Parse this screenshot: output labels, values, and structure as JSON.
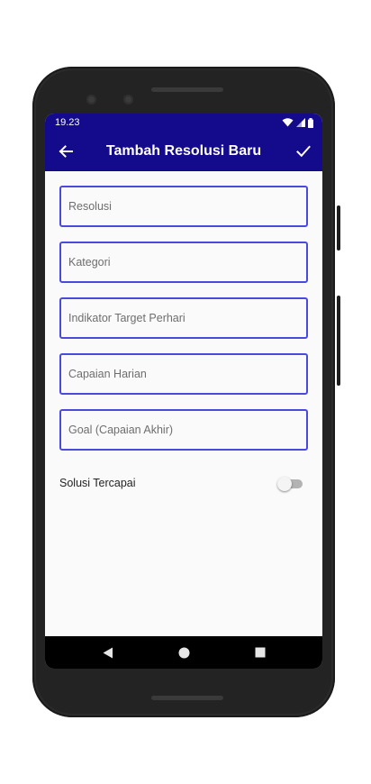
{
  "status_bar": {
    "time": "19.23"
  },
  "app_bar": {
    "title": "Tambah Resolusi Baru",
    "back_icon": "arrow-left-icon",
    "confirm_icon": "check-icon"
  },
  "form": {
    "fields": [
      {
        "placeholder": "Resolusi",
        "value": ""
      },
      {
        "placeholder": "Kategori",
        "value": ""
      },
      {
        "placeholder": "Indikator Target Perhari",
        "value": ""
      },
      {
        "placeholder": "Capaian Harian",
        "value": ""
      },
      {
        "placeholder": "Goal (Capaian Akhir)",
        "value": ""
      }
    ],
    "switch": {
      "label": "Solusi Tercapai",
      "checked": false
    }
  },
  "colors": {
    "primary": "#140b8c",
    "field_border": "#4a4adf",
    "background": "#fafafa"
  }
}
